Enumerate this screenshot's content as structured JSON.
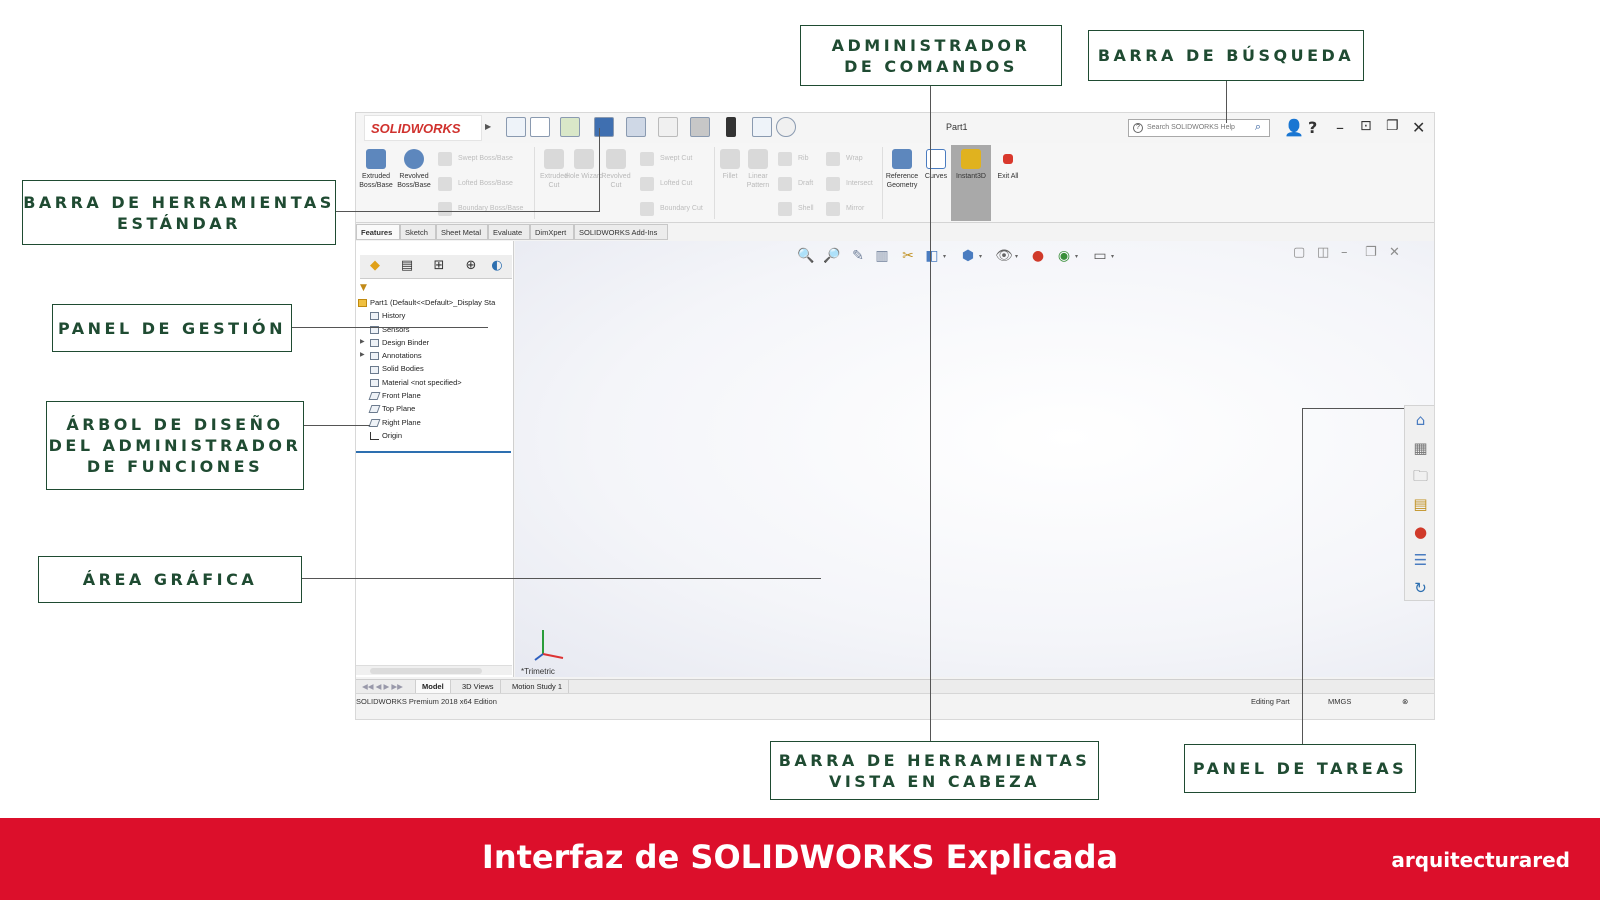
{
  "window": {
    "logo": "SOLIDWORKS",
    "title": "Part1",
    "search_placeholder": "Search SOLIDWORKS Help",
    "help_icon": "?"
  },
  "ribbon": {
    "extruded_boss": "Extruded Boss/Base",
    "revolved_boss": "Revolved Boss/Base",
    "swept_boss": "Swept Boss/Base",
    "lofted_boss": "Lofted Boss/Base",
    "boundary_boss": "Boundary Boss/Base",
    "extruded_cut": "Extruded Cut",
    "hole_wizard": "Hole Wizard",
    "revolved_cut": "Revolved Cut",
    "swept_cut": "Swept Cut",
    "lofted_cut": "Lofted Cut",
    "boundary_cut": "Boundary Cut",
    "fillet": "Fillet",
    "linear_pattern": "Linear Pattern",
    "rib": "Rib",
    "draft": "Draft",
    "shell": "Shell",
    "wrap": "Wrap",
    "intersect": "Intersect",
    "mirror": "Mirror",
    "reference_geometry": "Reference Geometry",
    "curves": "Curves",
    "instant3d": "Instant3D",
    "exit_all": "Exit All"
  },
  "command_tabs": [
    "Features",
    "Sketch",
    "Sheet Metal",
    "Evaluate",
    "DimXpert",
    "SOLIDWORKS Add-Ins"
  ],
  "tree": {
    "root": "Part1  (Default<<Default>_Display Sta",
    "items": [
      "History",
      "Sensors",
      "Design Binder",
      "Annotations",
      "Solid Bodies",
      "Material <not specified>",
      "Front Plane",
      "Top Plane",
      "Right Plane",
      "Origin"
    ]
  },
  "graphics": {
    "orientation": "*Trimetric"
  },
  "bottom_tabs": [
    "Model",
    "3D Views",
    "Motion Study 1"
  ],
  "status": {
    "edition": "SOLIDWORKS Premium 2018 x64 Edition",
    "mode": "Editing Part",
    "units": "MMGS"
  },
  "callouts": {
    "admin_comandos": "ADMINISTRADOR\nDE COMANDOS",
    "barra_busqueda": "BARRA DE BÚSQUEDA",
    "barra_estandar": "BARRA DE HERRAMIENTAS\nESTÁNDAR",
    "panel_gestion": "PANEL DE GESTIÓN",
    "arbol_diseno": "ÁRBOL DE DISEÑO\nDEL ADMINISTRADOR\nDE FUNCIONES",
    "area_grafica": "ÁREA GRÁFICA",
    "barra_vista": "BARRA DE HERRAMIENTAS\nVISTA EN CABEZA",
    "panel_tareas": "PANEL DE TAREAS"
  },
  "footer": {
    "title": "Interfaz de SOLIDWORKS Explicada",
    "brand": "arquitecturared"
  },
  "colors": {
    "footer_bg": "#dc0f2b",
    "callout_text": "#1f4b32",
    "solidworks_red": "#d0312d"
  }
}
